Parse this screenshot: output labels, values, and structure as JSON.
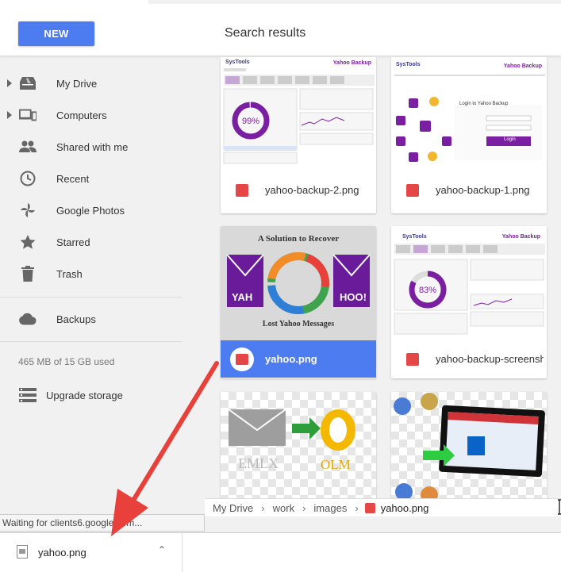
{
  "header": {
    "new_label": "NEW",
    "title": "Search results"
  },
  "sidebar": {
    "items": [
      {
        "label": "My Drive",
        "icon": "drive-icon",
        "expandable": true
      },
      {
        "label": "Computers",
        "icon": "computer-icon",
        "expandable": true
      },
      {
        "label": "Shared with me",
        "icon": "people-icon",
        "expandable": false
      },
      {
        "label": "Recent",
        "icon": "clock-icon",
        "expandable": false
      },
      {
        "label": "Google Photos",
        "icon": "pinwheel-icon",
        "expandable": false
      },
      {
        "label": "Starred",
        "icon": "star-icon",
        "expandable": false
      },
      {
        "label": "Trash",
        "icon": "trash-icon",
        "expandable": false
      }
    ],
    "backups": {
      "label": "Backups",
      "icon": "cloud-icon"
    },
    "quota": "465 MB of 15 GB used",
    "upgrade": {
      "label": "Upgrade storage",
      "icon": "storage-icon"
    }
  },
  "files": [
    {
      "name": "yahoo-backup-2.png",
      "selected": false,
      "thumbnail": "systools-backup-progress",
      "percent": "99%",
      "brand": "SysTools",
      "app_title": "Yahoo Backup"
    },
    {
      "name": "yahoo-backup-1.png",
      "selected": false,
      "thumbnail": "systools-login",
      "brand": "SysTools",
      "app_title": "Yahoo Backup",
      "login_heading": "Login to Yahoo Backup",
      "login_button": "Login"
    },
    {
      "name": "yahoo.png",
      "selected": true,
      "thumbnail": "yahoo-recover",
      "line1": "A Solution to Recover",
      "line2": "Lost Yahoo Messages",
      "yahoo_left": "YAH",
      "yahoo_right": "HOO!"
    },
    {
      "name": "yahoo-backup-screenshot.png",
      "selected": false,
      "thumbnail": "systools-backup-progress",
      "percent": "83%",
      "brand": "SysTools",
      "app_title": "Yahoo Backup"
    },
    {
      "name": "",
      "selected": false,
      "thumbnail": "emlx-to-olm",
      "from_label": "EMLX",
      "to_label": "OLM"
    },
    {
      "name": "",
      "selected": false,
      "thumbnail": "tablet-outlook"
    }
  ],
  "breadcrumb": {
    "items": [
      "My Drive",
      "work",
      "images"
    ],
    "current": "yahoo.png"
  },
  "status": {
    "text": "Waiting for clients6.google.com..."
  },
  "download": {
    "file": "yahoo.png"
  },
  "colors": {
    "accent": "#4d7cf0",
    "image_icon": "#e54646",
    "annotation_arrow": "#e8403a",
    "purple": "#7b1fa2"
  }
}
